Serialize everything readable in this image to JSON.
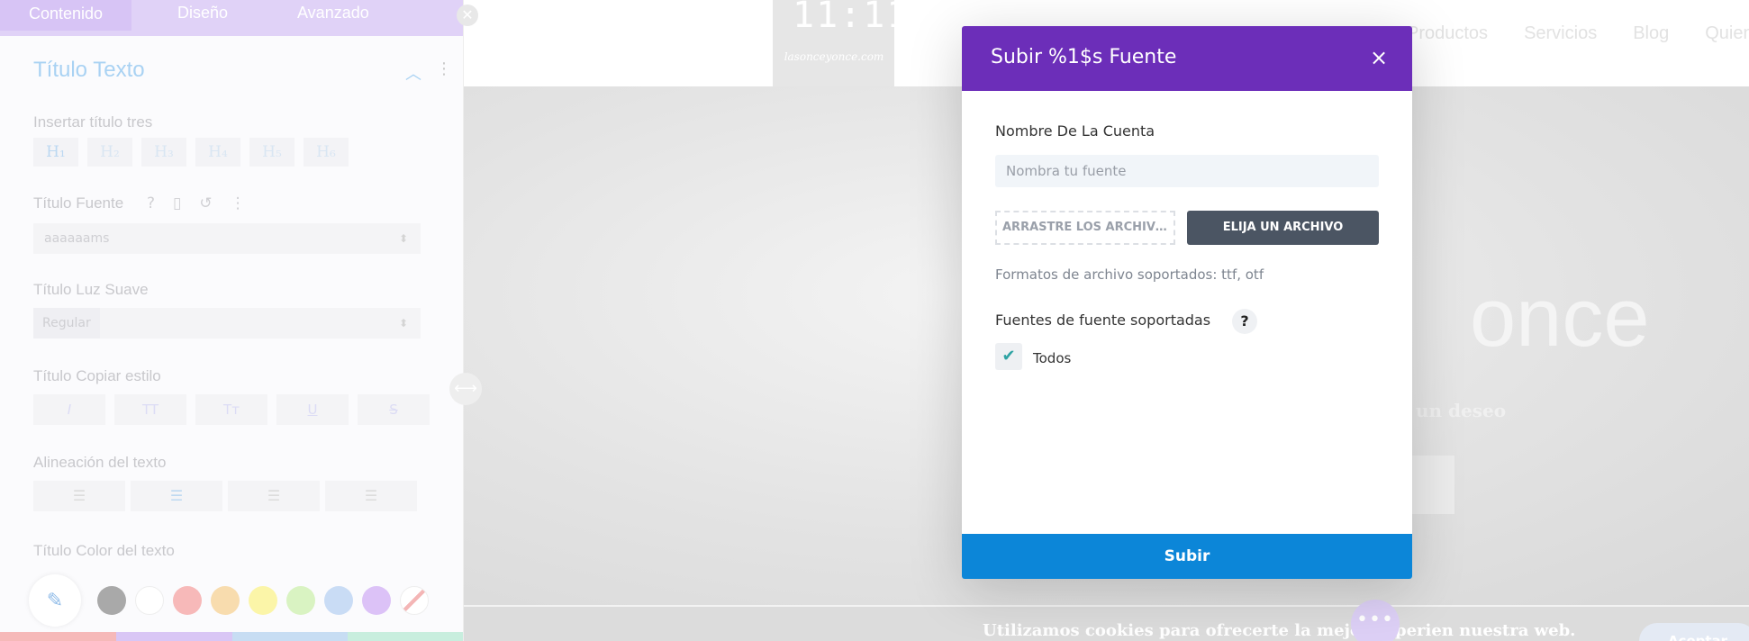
{
  "panel": {
    "tabs": [
      "Contenido",
      "Diseño",
      "Avanzado"
    ],
    "section_title": "Título Texto",
    "heading_level_label": "Insertar título tres",
    "heading_buttons": [
      "H₁",
      "H₂",
      "H₃",
      "H₄",
      "H₅",
      "H₆"
    ],
    "font_label": "Título Fuente",
    "font_value": "aaaaaams",
    "weight_label": "Título Luz Suave",
    "weight_value": "Regular",
    "style_label": "Título Copiar estilo",
    "style_buttons": [
      "I",
      "TT",
      "Tт",
      "U",
      "S"
    ],
    "align_label": "Alineación del texto",
    "color_label": "Título Color del texto",
    "swatches": [
      "#a9a9a9",
      "#ffffff",
      "#f7b9b9",
      "#f8dcae",
      "#fbf5a8",
      "#d9f3c2",
      "#c9dcf5",
      "#dcc2f7",
      "none"
    ]
  },
  "site": {
    "nav": [
      "Productos",
      "Servicios",
      "Blog",
      "Quiene"
    ],
    "logo_mark": "11:11",
    "logo_script": "lasonceyonce.com",
    "hero_title": "once",
    "hero_sub": "un deseo",
    "cookie_text": "Utilizamos cookies para ofrecerte la mejor experien       nuestra web.",
    "accept_label": "Aceptar",
    "dots": "•••"
  },
  "modal": {
    "title": "Subir %1$s Fuente",
    "close": "×",
    "name_label": "Nombre De La Cuenta",
    "name_placeholder": "Nombra tu fuente",
    "drop_label": "ARRASTRE LOS ARCHIVOS AQUÍ",
    "choose_label": "ELIJA UN ARCHIVO",
    "formats": "Formatos de archivo soportados: ttf, otf",
    "styles_label": "Fuentes de fuente soportadas",
    "help": "?",
    "check_label": "Todos",
    "submit": "Subir"
  },
  "colors": {
    "modal_header": "#6c2eb9",
    "submit": "#0c86d8",
    "choose_button": "#4b5563"
  }
}
